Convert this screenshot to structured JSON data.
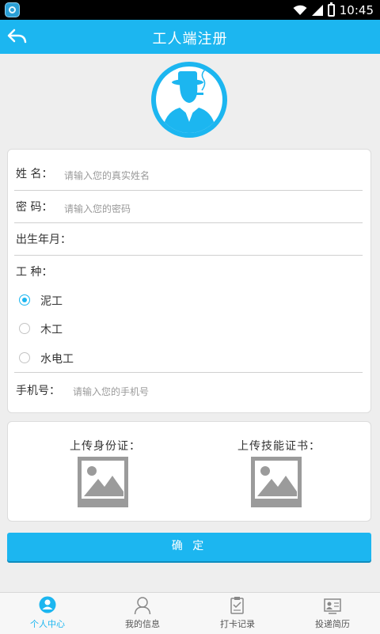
{
  "status_bar": {
    "time": "10:45"
  },
  "header": {
    "title": "工人端注册"
  },
  "form": {
    "name_label": "姓 名：",
    "name_placeholder": "请输入您的真实姓名",
    "password_label": "密 码：",
    "password_placeholder": "请输入您的密码",
    "birth_label": "出生年月：",
    "worktype_label": "工 种：",
    "worktype_options": [
      {
        "label": "泥工",
        "selected": true
      },
      {
        "label": "木工",
        "selected": false
      },
      {
        "label": "水电工",
        "selected": false
      }
    ],
    "phone_label": "手机号：",
    "phone_placeholder": "请输入您的手机号"
  },
  "upload": {
    "id_card_label": "上传身份证：",
    "skill_cert_label": "上传技能证书："
  },
  "confirm_label": "确 定",
  "bottom_nav": {
    "items": [
      {
        "label": "个人中心",
        "icon": "user-filled-icon",
        "active": true
      },
      {
        "label": "我的信息",
        "icon": "user-outline-icon",
        "active": false
      },
      {
        "label": "打卡记录",
        "icon": "clipboard-icon",
        "active": false
      },
      {
        "label": "投递简历",
        "icon": "resume-icon",
        "active": false
      }
    ]
  },
  "colors": {
    "accent": "#1cb6f0",
    "background": "#eeeeee"
  }
}
